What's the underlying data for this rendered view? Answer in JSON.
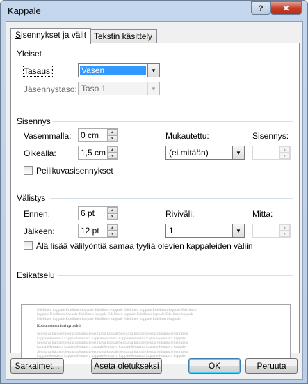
{
  "window": {
    "title": "Kappale",
    "help_label": "?",
    "close_label": "✕"
  },
  "tabs": [
    {
      "label": "Sisennykset ja välit",
      "underline": "S",
      "rest": "isennykset ja välit",
      "active": true
    },
    {
      "label": "Tekstin käsittely",
      "underline": "T",
      "rest": "ekstin käsittely",
      "active": false
    }
  ],
  "general": {
    "heading": "Yleiset",
    "alignment_label": "Tasaus:",
    "alignment_value": "Vasen",
    "outline_label": "Jäsennystaso:",
    "outline_value": "Taso 1"
  },
  "indentation": {
    "heading": "Sisennys",
    "left_label": "Vasemmalla:",
    "left_value": "0 cm",
    "right_label": "Oikealla:",
    "right_value": "1,5 cm",
    "special_label": "Mukautettu:",
    "special_value": "(ei mitään)",
    "by_label": "Sisennys:",
    "by_value": "",
    "mirror_label": "Peilikuvasisennykset",
    "mirror_checked": false
  },
  "spacing": {
    "heading": "Välistys",
    "before_label": "Ennen:",
    "before_value": "6 pt",
    "after_label": "Jälkeen:",
    "after_value": "12 pt",
    "line_label": "Riviväli:",
    "line_value": "1",
    "at_label": "Mitta:",
    "at_value": "",
    "no_space_label": "Älä lisää välilyöntiä samaa tyyliä olevien kappaleiden väliin",
    "no_space_checked": false
  },
  "preview": {
    "heading": "Esikatselu",
    "prev_lines": [
      "Edellinen kappale Edellinen kappale Edellinen kappale Edellinen kappale Edellinen kappale Edellinen",
      "kappale Edellinen kappale Edellinen kappale Edellinen kappale Edellinen kappale Edellinen kappale",
      "Edellinen kappale Edellinen kappale Edellinen kappale Edellinen kappale Edellinen kappale"
    ],
    "current_text": "Koulutussuunnittelugrojekti",
    "next_lines": [
      "Seuraava kappaleSeuraava kappaleSeuraava kappaleSeuraava kappaleSeuraava kappaleSeuraava",
      "kappaleSeuraava kappaleSeuraava kappaleSeuraava kappaleSeuraava kappaleSeuraava kappale",
      "Seuraava kappaleSeuraava kappaleSeuraava kappaleSeuraava kappaleSeuraava kappaleSeuraava",
      "kappaleSeuraava kappaleSeuraava kappaleSeuraava kappaleSeuraava kappaleSeuraava kappale",
      "Seuraava kappaleSeuraava kappaleSeuraava kappaleSeuraava kappaleSeuraava kappaleSeuraava",
      "kappaleSeuraava kappaleSeuraava kappaleSeuraava kappaleSeuraava kappaleSeuraava kappale"
    ]
  },
  "buttons": {
    "tabs_label": "Sarkaimet...",
    "default_label": "Aseta oletukseksi",
    "ok_label": "OK",
    "cancel_label": "Peruuta"
  },
  "icons": {
    "dropdown": "chevron-down-icon",
    "spin_up": "triangle-up-icon",
    "spin_down": "triangle-down-icon"
  }
}
